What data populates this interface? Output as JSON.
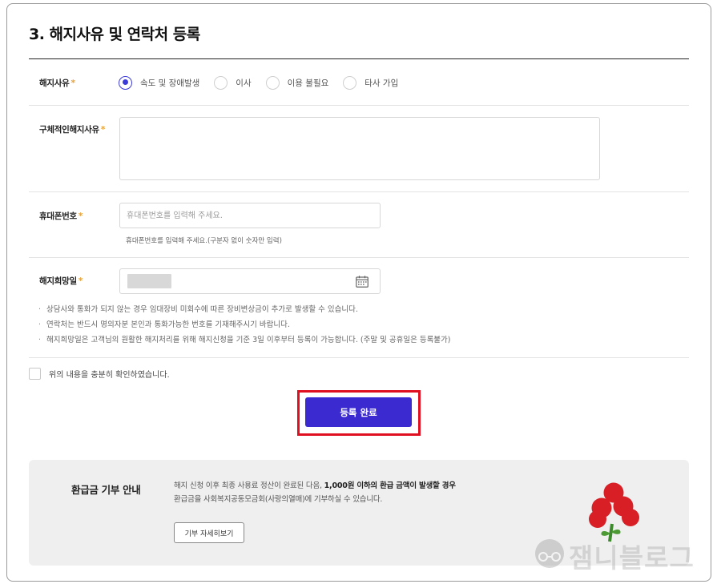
{
  "section": {
    "title": "3. 해지사유 및 연락처 등록"
  },
  "form": {
    "reason": {
      "label": "해지사유",
      "required_mark": "*",
      "options": [
        "속도 및 장애발생",
        "이사",
        "이용 불필요",
        "타사 가입"
      ],
      "selected": "속도 및 장애발생"
    },
    "detail": {
      "label": "구체적인해지사유",
      "required_mark": "*"
    },
    "phone": {
      "label": "휴대폰번호",
      "required_mark": "*",
      "placeholder": "휴대폰번호를 입력해 주세요.",
      "helper": "휴대폰번호를 입력해 주세요.(구분자 없이 숫자만 입력)"
    },
    "date": {
      "label": "해지희망일",
      "required_mark": "*",
      "icon": "calendar-icon"
    }
  },
  "notes": [
    "상담사와 통화가 되지 않는 경우 임대장비 미회수에 따른 장비변상금이 추가로 발생할 수 있습니다.",
    "연락처는 반드시 명의자분 본인과 통화가능한 번호를 기재해주시기 바랍니다.",
    "해지희망일은 고객님의 원활한 해지처리를 위해 해지신청을 기준 3일 이후부터 등록이 가능합니다. (주말 및 공휴일은 등록불가)"
  ],
  "agree": {
    "label": "위의 내용을 충분히 확인하였습니다.",
    "checked": false
  },
  "submit": {
    "label": "등록 완료"
  },
  "donation": {
    "title": "환급금 기부 안내",
    "line1_prefix": "해지 신청 이후 최종 사용료 정산이 완료된 다음, ",
    "line1_bold": "1,000원 이하의 환급 금액이 발생할 경우",
    "line2": "환급금을 사회복지공동모금회(사랑의열매)에 기부하실 수 있습니다.",
    "button": "기부 자세히보기"
  },
  "watermark": {
    "text": "잼니블로그"
  },
  "colors": {
    "accent": "#3a2ad0",
    "required": "#e8a23a",
    "highlight": "#e01020",
    "fruit_red": "#d81f26"
  }
}
